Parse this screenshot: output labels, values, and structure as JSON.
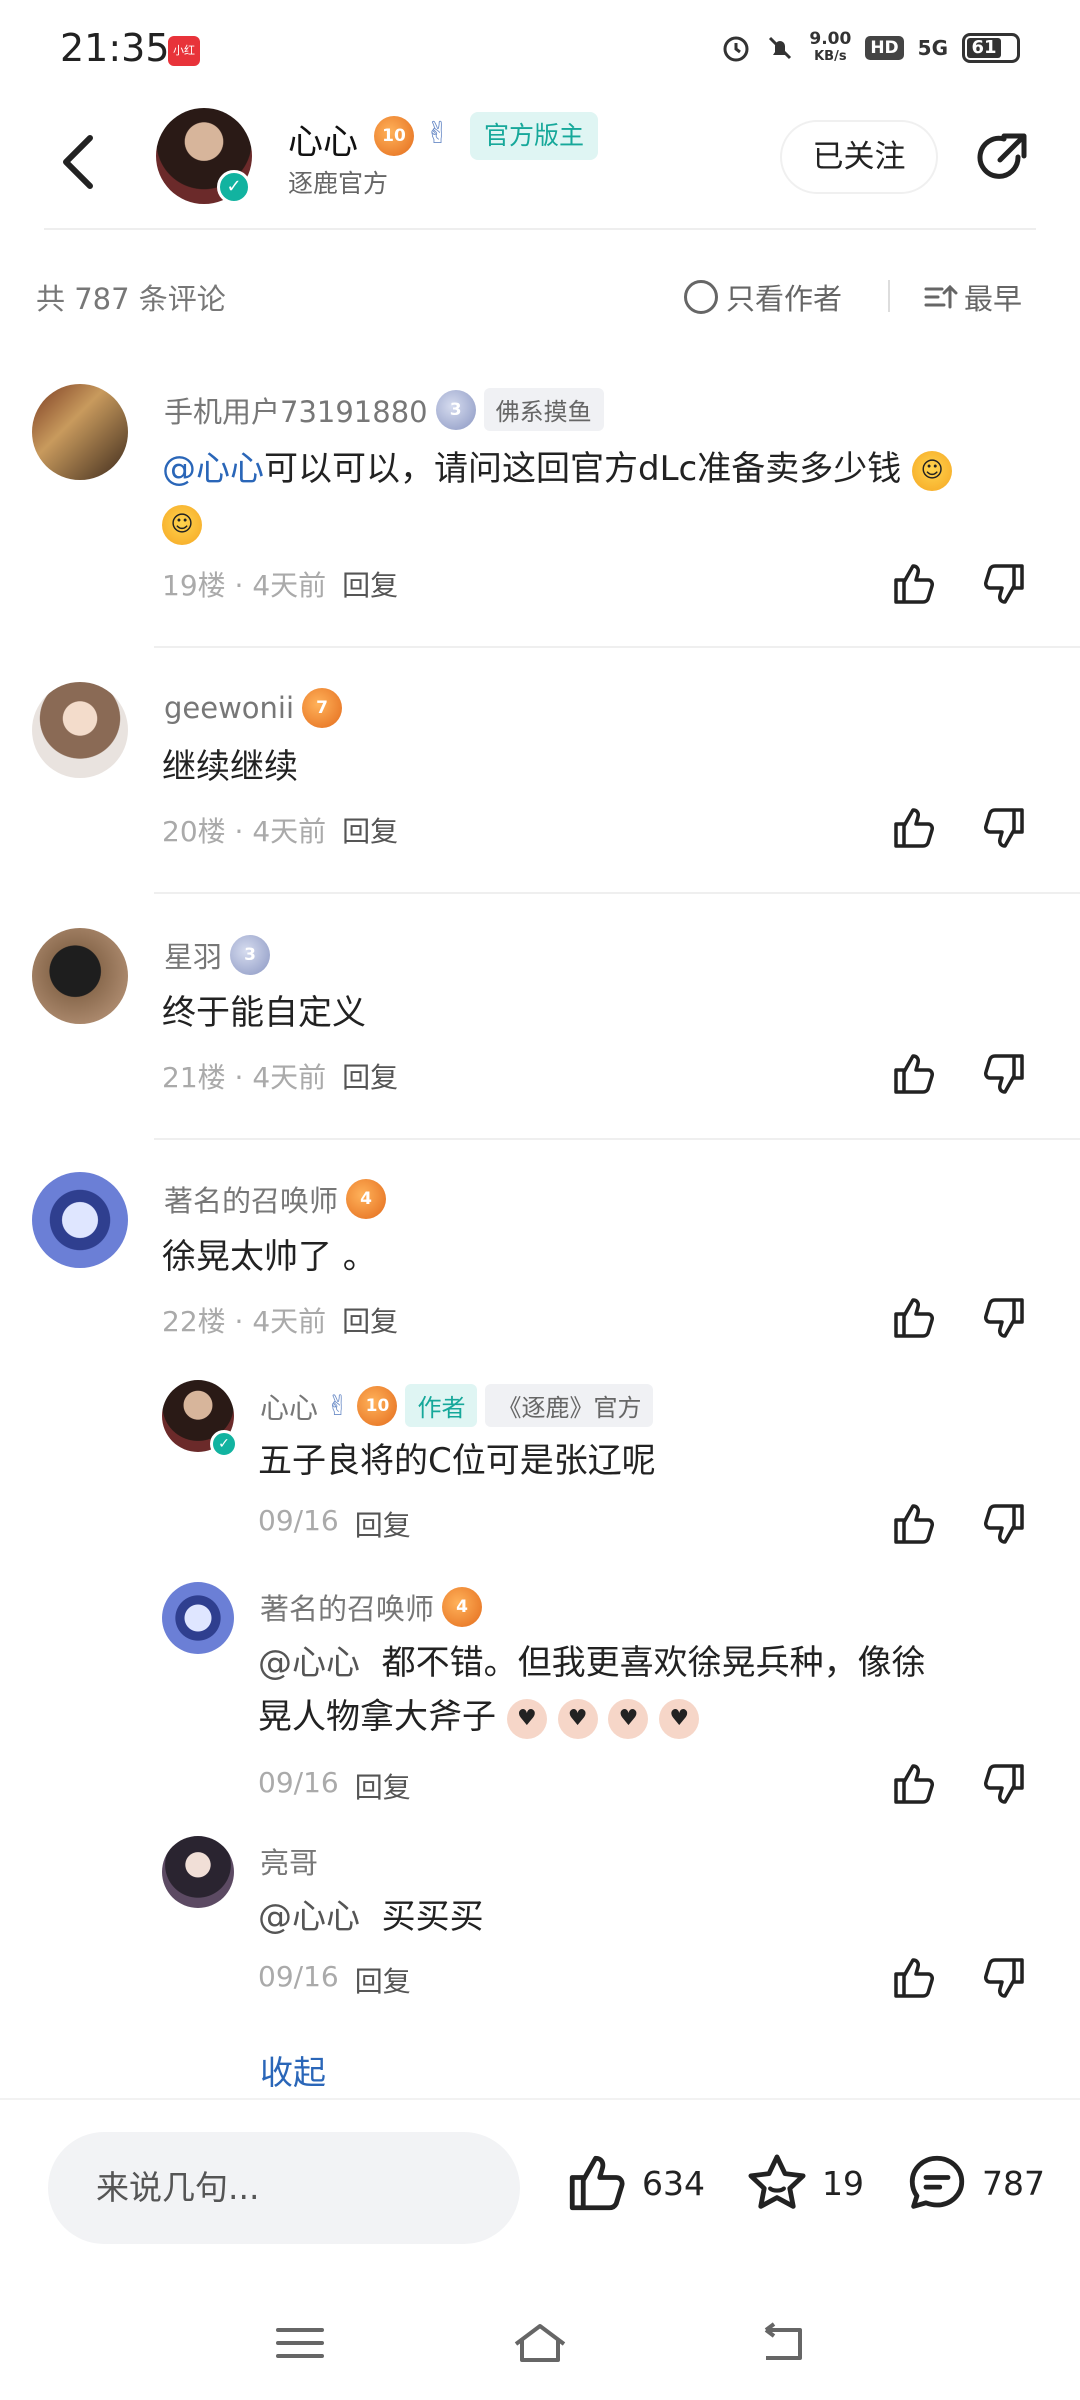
{
  "status_bar": {
    "time": "21:35",
    "app_icon_text": "小红书",
    "speed": "9.00",
    "speed_unit": "KB/s",
    "hd": "HD",
    "network": "5G",
    "battery": "61"
  },
  "header": {
    "name": "心心",
    "subtitle": "逐鹿官方",
    "level": "10",
    "badge": "官方版主",
    "follow_label": "已关注"
  },
  "sort": {
    "count": "共 787 条评论",
    "author_only": "只看作者",
    "earliest": "最早"
  },
  "comments": [
    {
      "user": "手机用户73191880",
      "level": "3",
      "tag": "佛系摸鱼",
      "mention": "@心心",
      "text": "可以可以，请问这回官方dLc准备卖多少钱",
      "floor": "19楼 · 4天前",
      "reply": "回复"
    },
    {
      "user": "geewonii",
      "level": "7",
      "text": "继续继续",
      "floor": "20楼 · 4天前",
      "reply": "回复"
    },
    {
      "user": "星羽",
      "level": "3",
      "text": "终于能自定义",
      "floor": "21楼 · 4天前",
      "reply": "回复"
    },
    {
      "user": "著名的召唤师",
      "level": "4",
      "text": "徐晃太帅了 。",
      "floor": "22楼 · 4天前",
      "reply": "回复"
    }
  ],
  "replies": [
    {
      "user": "心心",
      "level": "10",
      "tag_author": "作者",
      "tag_official": "《逐鹿》官方",
      "text": "五子良将的C位可是张辽呢",
      "date": "09/16",
      "reply": "回复"
    },
    {
      "user": "著名的召唤师",
      "level": "4",
      "mention": "@心心",
      "text_line1": "都不错。但我更喜欢徐晃兵种，像徐",
      "text_line2": "晃人物拿大斧子",
      "date": "09/16",
      "reply": "回复"
    },
    {
      "user": "亮哥",
      "mention": "@心心",
      "text": "买买买",
      "date": "09/16",
      "reply": "回复"
    }
  ],
  "collapse": "收起",
  "bottom": {
    "placeholder": "来说几句...",
    "likes": "634",
    "favorites": "19",
    "comments": "787"
  },
  "colors": {
    "accent_blue": "#2a66b8",
    "official_green": "#16a89a",
    "level_orange": "#e36b1c"
  }
}
